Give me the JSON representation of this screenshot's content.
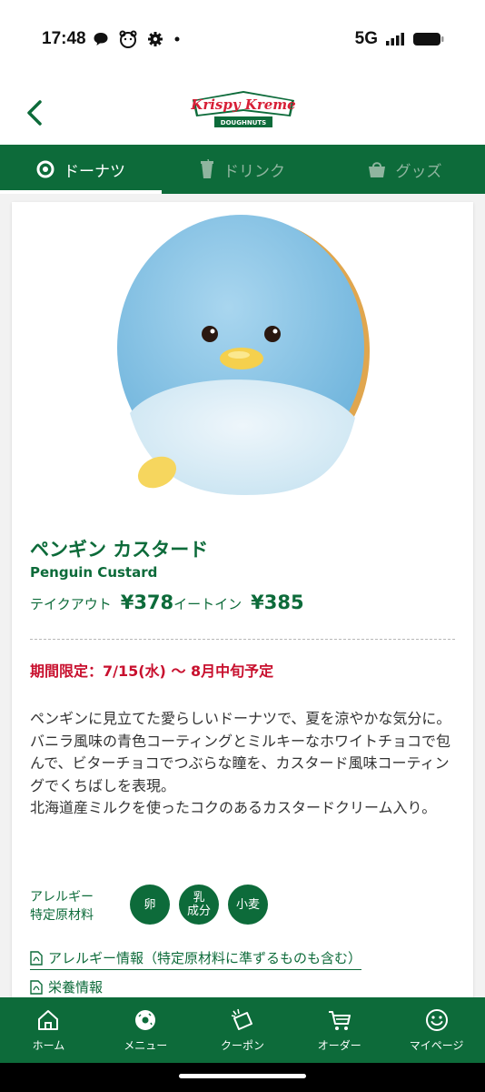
{
  "status_bar": {
    "time": "17:48",
    "network": "5G",
    "icons": [
      "chat-icon",
      "face-icon",
      "gear-icon",
      "dot-icon",
      "signal-icon",
      "battery-icon"
    ]
  },
  "header": {
    "back_icon": "chevron-left-icon",
    "logo_text": "Krispy Kreme",
    "logo_sub": "DOUGHNUTS"
  },
  "tabs": [
    {
      "label": "ドーナツ",
      "icon": "donut-icon",
      "active": true
    },
    {
      "label": "ドリンク",
      "icon": "cup-icon",
      "active": false
    },
    {
      "label": "グッズ",
      "icon": "bag-icon",
      "active": false
    }
  ],
  "product": {
    "name_ja": "ペンギン カスタード",
    "name_en": "Penguin Custard",
    "takeout_label": "テイクアウト",
    "takeout_price": "¥378",
    "eatin_label": "イートイン",
    "eatin_price": "¥385",
    "limited": "期間限定：7/15(水) 〜 8月中旬予定",
    "description": "ペンギンに見立てた愛らしいドーナツで、夏を涼やかな気分に。\nバニラ風味の青色コーティングとミルキーなホワイトチョコで包んで、ビターチョコでつぶらな瞳を、カスタード風味コーティングでくちばしを表現。\n北海道産ミルクを使ったコクのあるカスタードクリーム入り。",
    "allergy_label": "アレルギー\n特定原材料",
    "allergens": [
      "卵",
      "乳\n成分",
      "小麦"
    ],
    "link_allergy": "アレルギー情報（特定原材料に準ずるものも含む）",
    "link_nutrition": "栄養情報"
  },
  "bottom_nav": [
    {
      "label": "ホーム",
      "icon": "home-icon"
    },
    {
      "label": "メニュー",
      "icon": "donut-icon"
    },
    {
      "label": "クーポン",
      "icon": "coupon-icon"
    },
    {
      "label": "オーダー",
      "icon": "cart-icon"
    },
    {
      "label": "マイページ",
      "icon": "smile-icon"
    }
  ],
  "colors": {
    "brand_green": "#0d6b3a",
    "limited_red": "#c8102e",
    "logo_red": "#d71f36"
  }
}
